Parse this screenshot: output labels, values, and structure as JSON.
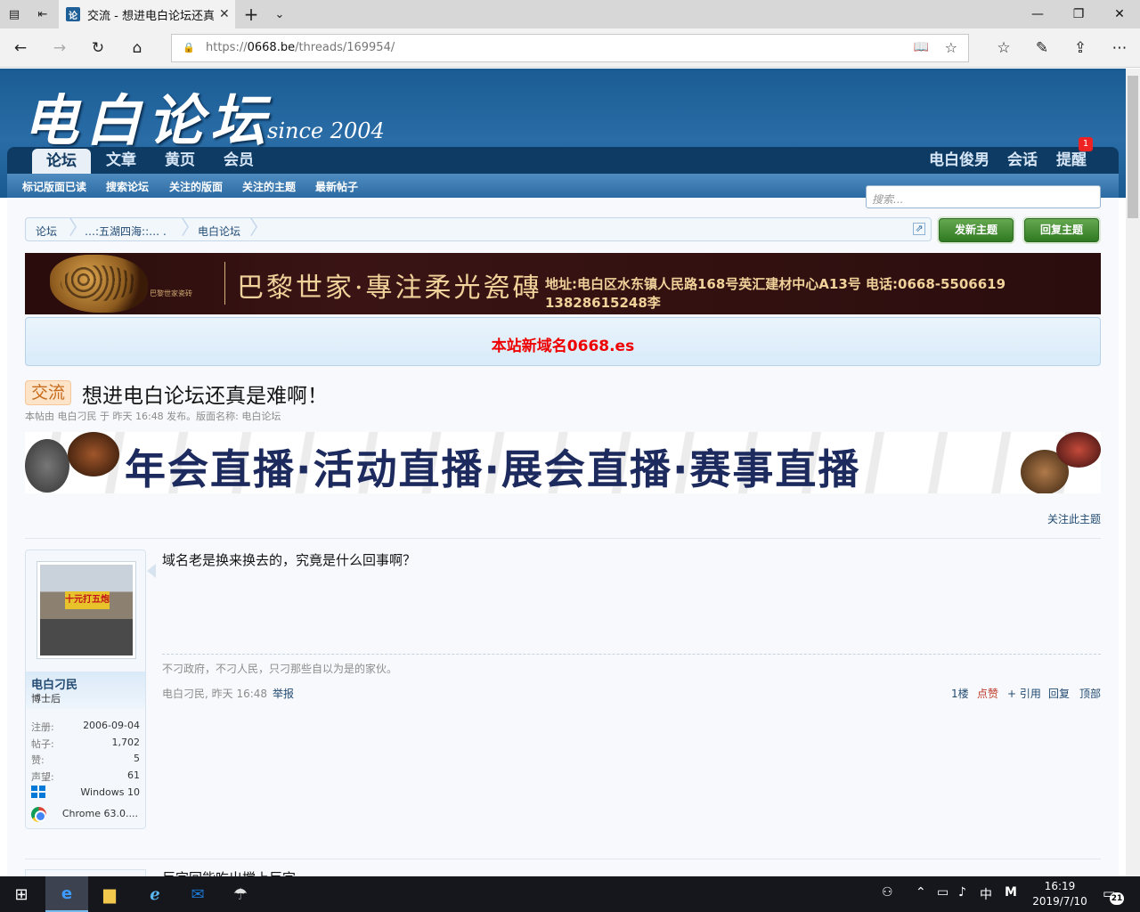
{
  "browser": {
    "tab_title": "交流 - 想进电白论坛还真是难啊！",
    "tab_icon": "论",
    "url_prefix": "https://",
    "url_host": "0668.be",
    "url_path": "/threads/169954/"
  },
  "site": {
    "logo": "电白论坛",
    "logo_sub": "since 2004",
    "nav": [
      "论坛",
      "文章",
      "黄页",
      "会员"
    ],
    "nav_right": [
      "电白俊男",
      "会话",
      "提醒"
    ],
    "alert_count": "1",
    "subnav": [
      "标记版面已读",
      "搜索论坛",
      "关注的版面",
      "关注的主题",
      "最新帖子"
    ],
    "search_placeholder": "搜索..."
  },
  "breadcrumb": [
    "论坛",
    "…:五湖四海::… .",
    "电白论坛"
  ],
  "actions": {
    "new_thread": "发新主题",
    "reply": "回复主题"
  },
  "ads": {
    "banner1_brand_small": "巴黎世家瓷砖",
    "banner1_headline": "巴黎世家·專注柔光瓷磚",
    "banner1_address": "地址:电白区水东镇人民路168号英汇建材中心A13号  电话:0668-5506619   13828615248李",
    "banner2_text": "年会直播·活动直播·展会直播·赛事直播"
  },
  "notice": "本站新域名0668.es",
  "thread": {
    "prefix": "交流",
    "title": "想进电白论坛还真是难啊！",
    "meta": "本帖由 电白刁民 于 昨天 16:48 发布。版面名称: 电白论坛",
    "watch": "关注此主题"
  },
  "post": {
    "user": "电白刁民",
    "user_title": "博士后",
    "avatar_sign": "十元打五炮",
    "stats": [
      {
        "k": "注册:",
        "v": "2006-09-04"
      },
      {
        "k": "帖子:",
        "v": "1,702"
      },
      {
        "k": "赞:",
        "v": "5"
      },
      {
        "k": "声望:",
        "v": "61"
      }
    ],
    "os": "Windows 10",
    "browser": "Chrome 63.0....",
    "message": "域名老是换来换去的，究竟是什么回事啊？",
    "signature": "不刁政府，不刁人民，只刁那些自以为是的家伙。",
    "meta": "电白刁民, 昨天 16:48",
    "report": "举报",
    "floor": "1楼",
    "like": "点赞",
    "quote": "+ 引用",
    "reply": "回复",
    "top": "顶部"
  },
  "next_post_message": "巨字回能吃出搅上巨字",
  "taskbar": {
    "clock_time": "16:19",
    "clock_date": "2019/7/10",
    "ime": "中",
    "notifications": "21"
  }
}
